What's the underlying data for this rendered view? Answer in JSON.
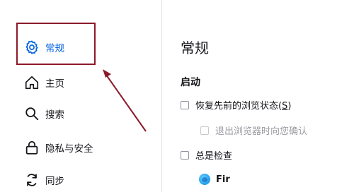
{
  "sidebar": {
    "items": [
      {
        "label": "常规",
        "icon": "gear-icon",
        "selected": true
      },
      {
        "label": "主页",
        "icon": "home-icon",
        "selected": false
      },
      {
        "label": "搜索",
        "icon": "search-icon",
        "selected": false
      },
      {
        "label": "隐私与安全",
        "icon": "lock-icon",
        "selected": false
      },
      {
        "label": "同步",
        "icon": "sync-icon",
        "selected": false
      }
    ]
  },
  "main": {
    "title": "常规",
    "startup": {
      "heading": "启动",
      "restore_session_label": "恢复先前的浏览状态(",
      "restore_session_key": "S",
      "restore_session_suffix": ")",
      "warn_on_quit_label": "退出浏览器时向您确认",
      "always_check_label": "总是检查",
      "default_browser_name": "Fir"
    }
  },
  "colors": {
    "accent": "#0061e0",
    "annotation": "#8b1a2b"
  }
}
